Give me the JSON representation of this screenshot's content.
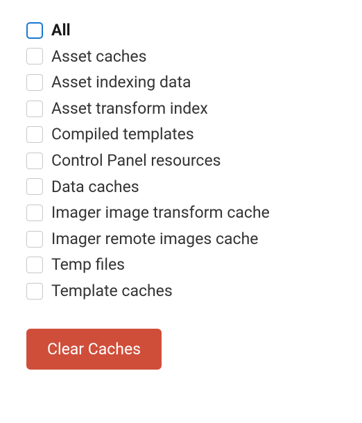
{
  "caches": {
    "all_label": "All",
    "items": [
      {
        "label": "Asset caches"
      },
      {
        "label": "Asset indexing data"
      },
      {
        "label": "Asset transform index"
      },
      {
        "label": "Compiled templates"
      },
      {
        "label": "Control Panel resources"
      },
      {
        "label": "Data caches"
      },
      {
        "label": "Imager image transform cache"
      },
      {
        "label": "Imager remote images cache"
      },
      {
        "label": "Temp files"
      },
      {
        "label": "Template caches"
      }
    ]
  },
  "button": {
    "clear_label": "Clear Caches"
  }
}
